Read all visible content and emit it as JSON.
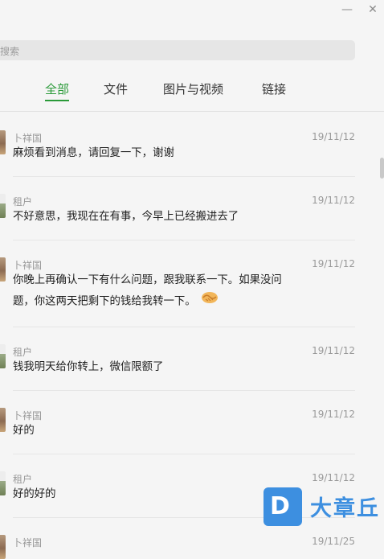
{
  "window": {
    "minimize_glyph": "—",
    "close_glyph": "✕"
  },
  "search": {
    "placeholder": "搜索"
  },
  "tabs": [
    {
      "label": "全部",
      "active": true
    },
    {
      "label": "文件",
      "active": false
    },
    {
      "label": "图片与视频",
      "active": false
    },
    {
      "label": "链接",
      "active": false
    }
  ],
  "messages": [
    {
      "sender": "卜祥国",
      "date": "19/11/12",
      "lines": [
        "麻烦看到消息，请回复一下，谢谢"
      ]
    },
    {
      "sender": "租户",
      "date": "19/11/12",
      "lines": [
        "不好意思，我现在在有事，今早上已经搬进去了"
      ]
    },
    {
      "sender": "卜祥国",
      "date": "19/11/12",
      "lines": [
        "你晚上再确认一下有什么问题，跟我联系一下。如果没问",
        "题，你这两天把剩下的钱给我转一下。"
      ],
      "emoji": "handshake-emoji"
    },
    {
      "sender": "租户",
      "date": "19/11/12",
      "lines": [
        "钱我明天给你转上，微信限额了"
      ]
    },
    {
      "sender": "卜祥国",
      "date": "19/11/12",
      "lines": [
        "好的"
      ]
    },
    {
      "sender": "租户",
      "date": "19/11/12",
      "lines": [
        "好的好的"
      ]
    },
    {
      "sender": "卜祥国",
      "date": "19/11/25",
      "lines": []
    }
  ],
  "watermark": {
    "text": "大章丘",
    "accent": "#3d8fe0"
  }
}
